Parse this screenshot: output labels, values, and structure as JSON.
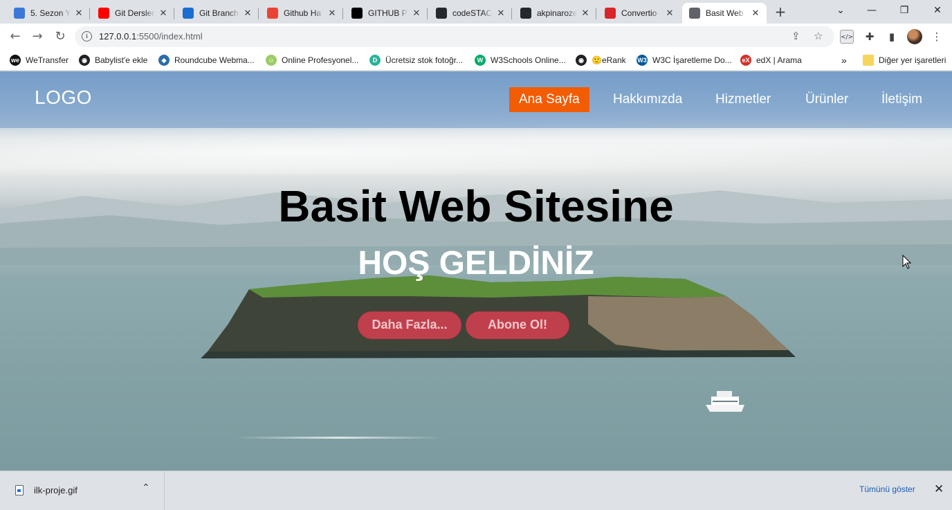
{
  "browser": {
    "tabs": [
      {
        "label": "5. Sezon Y",
        "icon": "profile-icon",
        "color": "#3c78d8"
      },
      {
        "label": "Git Dersler",
        "icon": "youtube-icon",
        "color": "#ff0000"
      },
      {
        "label": "Git Branch",
        "icon": "azure-icon",
        "color": "#1c6dd0"
      },
      {
        "label": "Github Ha",
        "icon": "gmail-icon",
        "color": "#ea4335"
      },
      {
        "label": "GITHUB PR",
        "icon": "medium-icon",
        "color": "#000000"
      },
      {
        "label": "codeSTACK",
        "icon": "github-icon",
        "color": "#24292f"
      },
      {
        "label": "akpinaroze",
        "icon": "github-icon",
        "color": "#24292f"
      },
      {
        "label": "Convertio",
        "icon": "convertio-icon",
        "color": "#d9252a"
      },
      {
        "label": "Basit Web",
        "icon": "globe-icon",
        "color": "#5f6368"
      }
    ],
    "active_tab": 8,
    "url_host": "127.0.0.1",
    "url_rest": ":5500/index.html",
    "bookmarks": [
      {
        "label": "WeTransfer",
        "icon": "wetransfer-icon",
        "color": "#111111",
        "glyph": "we"
      },
      {
        "label": "Babylist'e ekle",
        "icon": "globe-icon",
        "color": "#202124",
        "glyph": "◉"
      },
      {
        "label": "Roundcube Webma...",
        "icon": "roundcube-icon",
        "color": "#2a6ca8",
        "glyph": "◆"
      },
      {
        "label": "Online Profesyonel...",
        "icon": "smiley-icon",
        "color": "#9ccc65",
        "glyph": "☺"
      },
      {
        "label": "Ücretsiz stok fotoğr...",
        "icon": "stock-photo-icon",
        "color": "#2bb39a",
        "glyph": "D"
      },
      {
        "label": "W3Schools Online...",
        "icon": "w3schools-icon",
        "color": "#04aa6d",
        "glyph": "W"
      },
      {
        "label": "🙂eRank",
        "icon": "globe-icon",
        "color": "#202124",
        "glyph": "◉"
      },
      {
        "label": "W3C İşaretleme Do...",
        "icon": "w3c-icon",
        "color": "#005a9c",
        "glyph": "W3"
      },
      {
        "label": "edX | Arama",
        "icon": "edx-icon",
        "color": "#d23228",
        "glyph": "eX"
      }
    ],
    "bookmarks_more": "»",
    "other_bookmarks": "Diğer yer işaretleri"
  },
  "site": {
    "logo": "LOGO",
    "nav": [
      "Ana Sayfa",
      "Hakkımızda",
      "Hizmetler",
      "Ürünler",
      "İletişim"
    ],
    "active_nav": 0,
    "hero_title": "Basit Web Sitesine",
    "hero_subtitle": "HOŞ GELDİNİZ",
    "buttons": [
      "Daha Fazla...",
      "Abone Ol!"
    ],
    "accent_color": "#f25c05",
    "button_color": "#d64050"
  },
  "downloads": {
    "file_name": "ilk-proje.gif",
    "show_all": "Tümünü göster"
  }
}
